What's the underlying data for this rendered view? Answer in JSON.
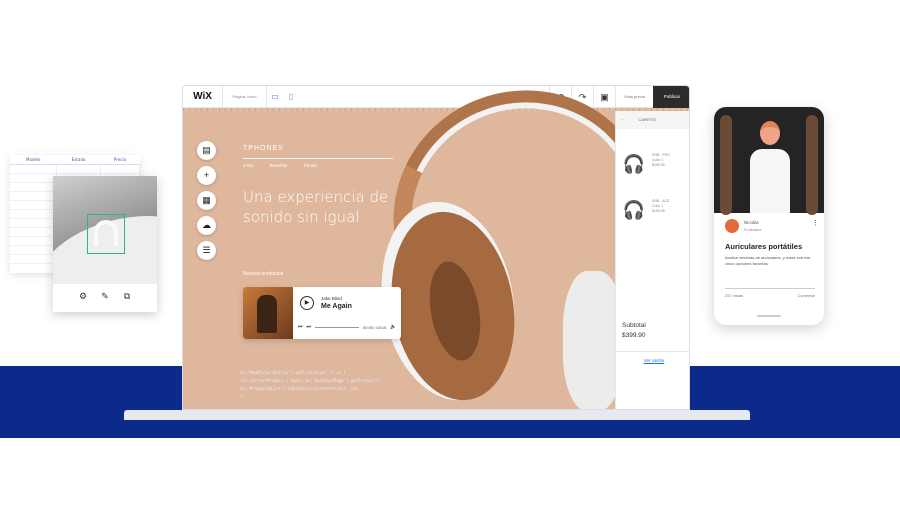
{
  "editor": {
    "logo": "WiX",
    "page_selector": "Página: Inicio",
    "preview_label": "Vista previa",
    "publish_label": "Publicar"
  },
  "site": {
    "brand": "TPHONES",
    "menu": [
      "Inicio",
      "Reseñas",
      "Tienda"
    ],
    "hero": "Una experiencia de sonido sin igual",
    "new_products": "Nuevos productos"
  },
  "player": {
    "artist": "Jake Blind",
    "track": "Me Again",
    "time": "00:00 / 03:15"
  },
  "cart": {
    "title": "CARRITO",
    "items": [
      {
        "name": "SNB - PRO",
        "color": "Color 1",
        "price": "$199,95"
      },
      {
        "name": "SNB - ACE",
        "color": "Color 1",
        "price": "$199,95"
      }
    ],
    "subtotal_label": "Subtotal",
    "subtotal": "$399.90",
    "view_cart": "Ver carrito"
  },
  "code": {
    "line1": "$w('#addToCartButton').onClick(async () => {",
    "line2": "  let currentProduct = await $w('#productPage').getProduct();",
    "line3": "  $w('#shoppingCart').addToCart(currentProduct._id)",
    "line4": "})"
  },
  "phone": {
    "author": "Nicolás",
    "time": "5 minutos",
    "title": "Auriculares portátiles",
    "body": "Analice decenas de auriculares, y estas son mis cinco opciones favoritas",
    "views": "257 vistas",
    "comment": "Comentar"
  },
  "sheet": {
    "headers": [
      "Modelo",
      "Estado",
      "Precio"
    ]
  },
  "colors": {
    "navy": "#0b2a8a",
    "tan": "#deb79d",
    "accent": "#116dff"
  }
}
